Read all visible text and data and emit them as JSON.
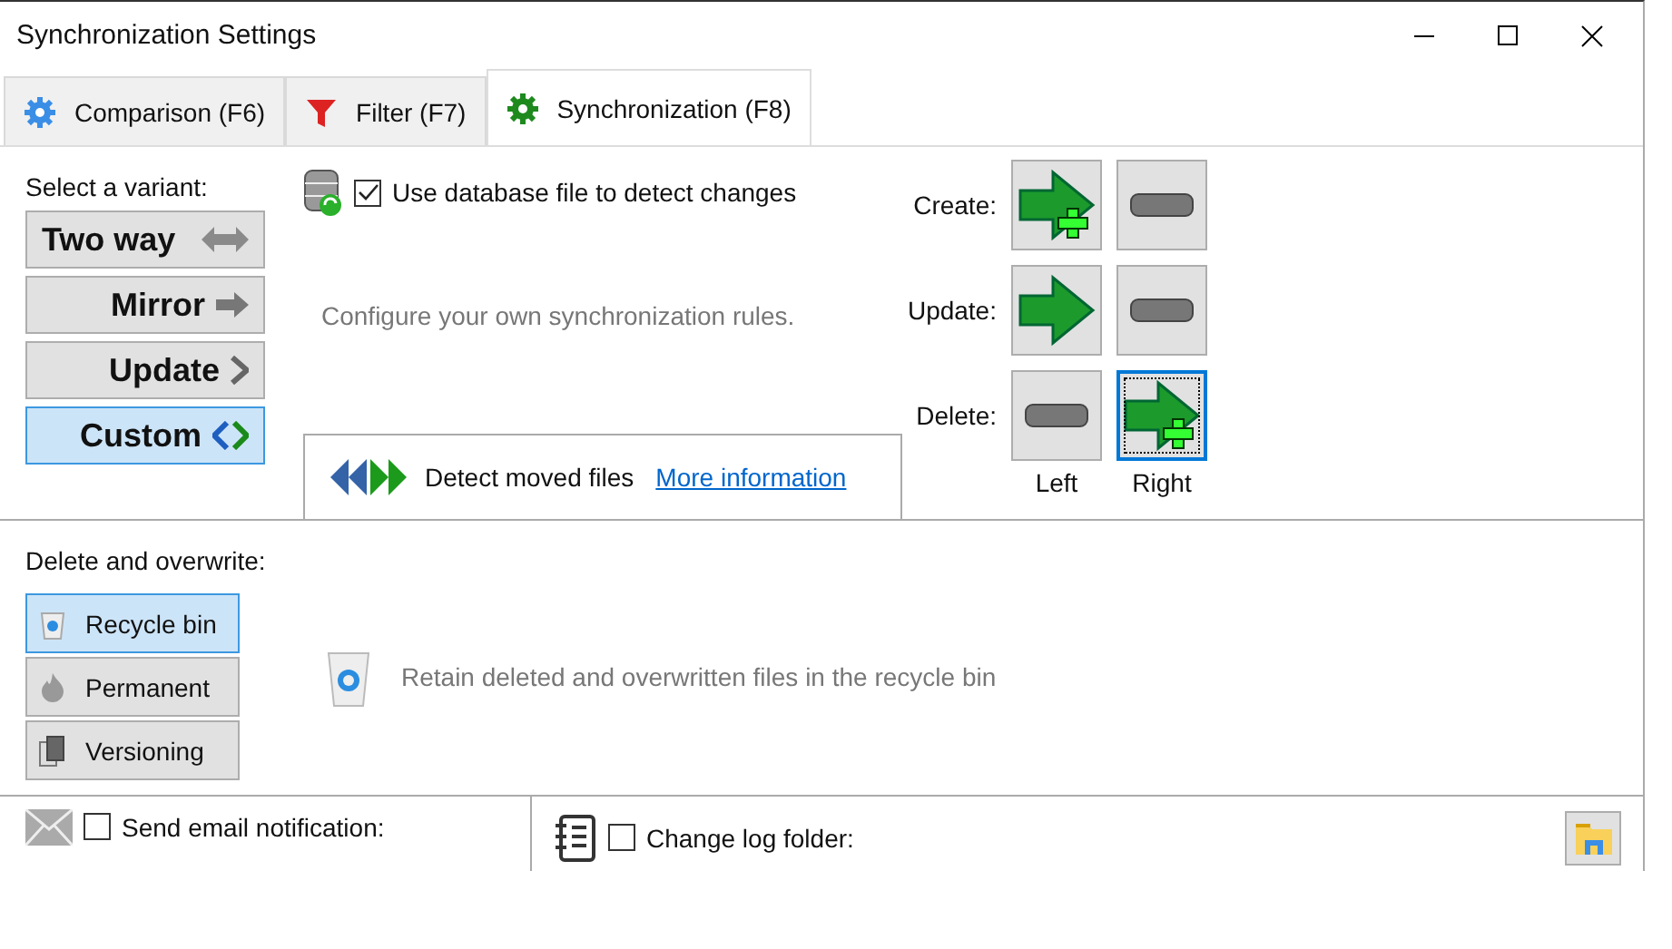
{
  "window": {
    "title": "Synchronization Settings"
  },
  "tabs": [
    {
      "label": "Comparison (F6)",
      "kind": "gear",
      "selected": false
    },
    {
      "label": "Filter (F7)",
      "kind": "funnel",
      "selected": false
    },
    {
      "label": "Synchronization (F8)",
      "kind": "gear-green",
      "selected": true
    }
  ],
  "variant_heading": "Select a variant:",
  "variants": [
    {
      "label": "Two way",
      "kind": "both",
      "selected": false
    },
    {
      "label": "Mirror",
      "kind": "right",
      "selected": false
    },
    {
      "label": "Update",
      "kind": "chevron",
      "selected": false
    },
    {
      "label": "Custom",
      "kind": "custom",
      "selected": true
    }
  ],
  "database": {
    "label": "Use database file to detect changes",
    "checked": true
  },
  "description": "Configure your own synchronization rules.",
  "detect_moved": {
    "label": "Detect moved files",
    "link": "More information"
  },
  "rules": [
    {
      "label": "Create:",
      "left": {
        "kind": "create",
        "selected": false
      },
      "right": {
        "kind": "none",
        "selected": false
      }
    },
    {
      "label": "Update:",
      "left": {
        "kind": "overwrite",
        "selected": false
      },
      "right": {
        "kind": "none",
        "selected": false
      }
    },
    {
      "label": "Delete:",
      "left": {
        "kind": "none",
        "selected": false
      },
      "right": {
        "kind": "create",
        "selected": true
      }
    }
  ],
  "columns": [
    "Left",
    "Right"
  ],
  "delete_heading": "Delete and overwrite:",
  "delete_options": [
    {
      "label": "Recycle bin",
      "kind": "bin",
      "selected": true
    },
    {
      "label": "Permanent",
      "kind": "flame",
      "selected": false
    },
    {
      "label": "Versioning",
      "kind": "pages",
      "selected": false
    }
  ],
  "delete_description": "Retain deleted and overwritten files in the recycle bin",
  "email": {
    "label": "Send email notification:",
    "checked": false
  },
  "log_folder": {
    "label": "Change log folder:",
    "checked": false
  }
}
